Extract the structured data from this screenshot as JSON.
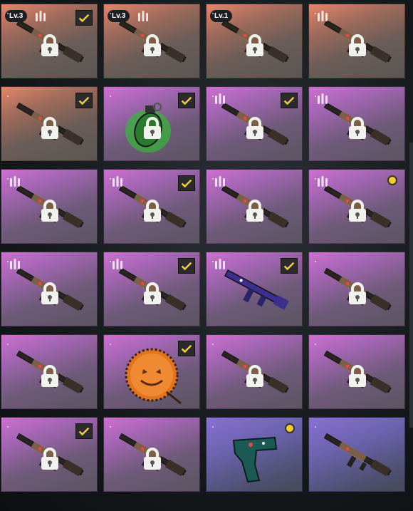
{
  "accent_colors": {
    "orange_tier": "#e6846a",
    "purple_tier": "#cf6fd0",
    "violet_tier": "#8a70d6",
    "check_yellow": "#f5d23a"
  },
  "items": [
    {
      "rarity": "orange",
      "level": "Lv.3",
      "ammo": true,
      "checked": true,
      "locked": true,
      "weapon": "rifle-icon"
    },
    {
      "rarity": "orange",
      "level": "Lv.3",
      "ammo": true,
      "checked": false,
      "locked": true,
      "weapon": "rifle-icon"
    },
    {
      "rarity": "orange",
      "level": "Lv.1",
      "ammo": false,
      "checked": false,
      "locked": true,
      "weapon": "rifle-icon"
    },
    {
      "rarity": "orange",
      "level": "",
      "ammo": true,
      "checked": false,
      "locked": true,
      "weapon": "rifle-icon"
    },
    {
      "rarity": "orange",
      "level": "",
      "ammo": false,
      "checked": true,
      "locked": true,
      "weapon": "rifle-icon"
    },
    {
      "rarity": "purple",
      "level": "",
      "ammo": false,
      "checked": true,
      "locked": true,
      "weapon": "grenade-icon"
    },
    {
      "rarity": "purple",
      "level": "",
      "ammo": true,
      "checked": true,
      "locked": true,
      "weapon": "rifle-icon"
    },
    {
      "rarity": "purple",
      "level": "",
      "ammo": true,
      "checked": false,
      "locked": true,
      "weapon": "rifle-icon"
    },
    {
      "rarity": "purple",
      "level": "",
      "ammo": true,
      "checked": false,
      "locked": true,
      "weapon": "rifle-icon"
    },
    {
      "rarity": "purple",
      "level": "",
      "ammo": true,
      "checked": true,
      "locked": true,
      "weapon": "rifle-icon"
    },
    {
      "rarity": "purple",
      "level": "",
      "ammo": true,
      "checked": false,
      "locked": true,
      "weapon": "rifle-icon"
    },
    {
      "rarity": "purple",
      "level": "",
      "ammo": true,
      "checked": false,
      "locked": true,
      "weapon": "rifle-icon",
      "dot": true
    },
    {
      "rarity": "purple",
      "level": "",
      "ammo": true,
      "checked": false,
      "locked": true,
      "weapon": "rifle-icon"
    },
    {
      "rarity": "purple",
      "level": "",
      "ammo": true,
      "checked": true,
      "locked": true,
      "weapon": "rifle-icon"
    },
    {
      "rarity": "purple",
      "level": "",
      "ammo": true,
      "checked": true,
      "locked": false,
      "weapon": "smg-icon"
    },
    {
      "rarity": "purple",
      "level": "",
      "ammo": false,
      "checked": false,
      "locked": true,
      "weapon": "rifle-icon"
    },
    {
      "rarity": "purple",
      "level": "",
      "ammo": false,
      "checked": false,
      "locked": true,
      "weapon": "rifle-icon"
    },
    {
      "rarity": "purple",
      "level": "",
      "ammo": false,
      "checked": true,
      "locked": false,
      "weapon": "pumpkin-icon"
    },
    {
      "rarity": "purple",
      "level": "",
      "ammo": false,
      "checked": false,
      "locked": true,
      "weapon": "rifle-icon"
    },
    {
      "rarity": "purple",
      "level": "",
      "ammo": false,
      "checked": false,
      "locked": true,
      "weapon": "rifle-icon"
    },
    {
      "rarity": "purple",
      "level": "",
      "ammo": false,
      "checked": true,
      "locked": true,
      "weapon": "rifle-icon"
    },
    {
      "rarity": "purple",
      "level": "",
      "ammo": false,
      "checked": false,
      "locked": true,
      "weapon": "rifle-icon"
    },
    {
      "rarity": "violet",
      "level": "",
      "ammo": false,
      "checked": false,
      "locked": false,
      "weapon": "pistol-icon",
      "dot": true
    },
    {
      "rarity": "violet",
      "level": "",
      "ammo": false,
      "checked": false,
      "locked": false,
      "weapon": "rifle-icon"
    }
  ]
}
